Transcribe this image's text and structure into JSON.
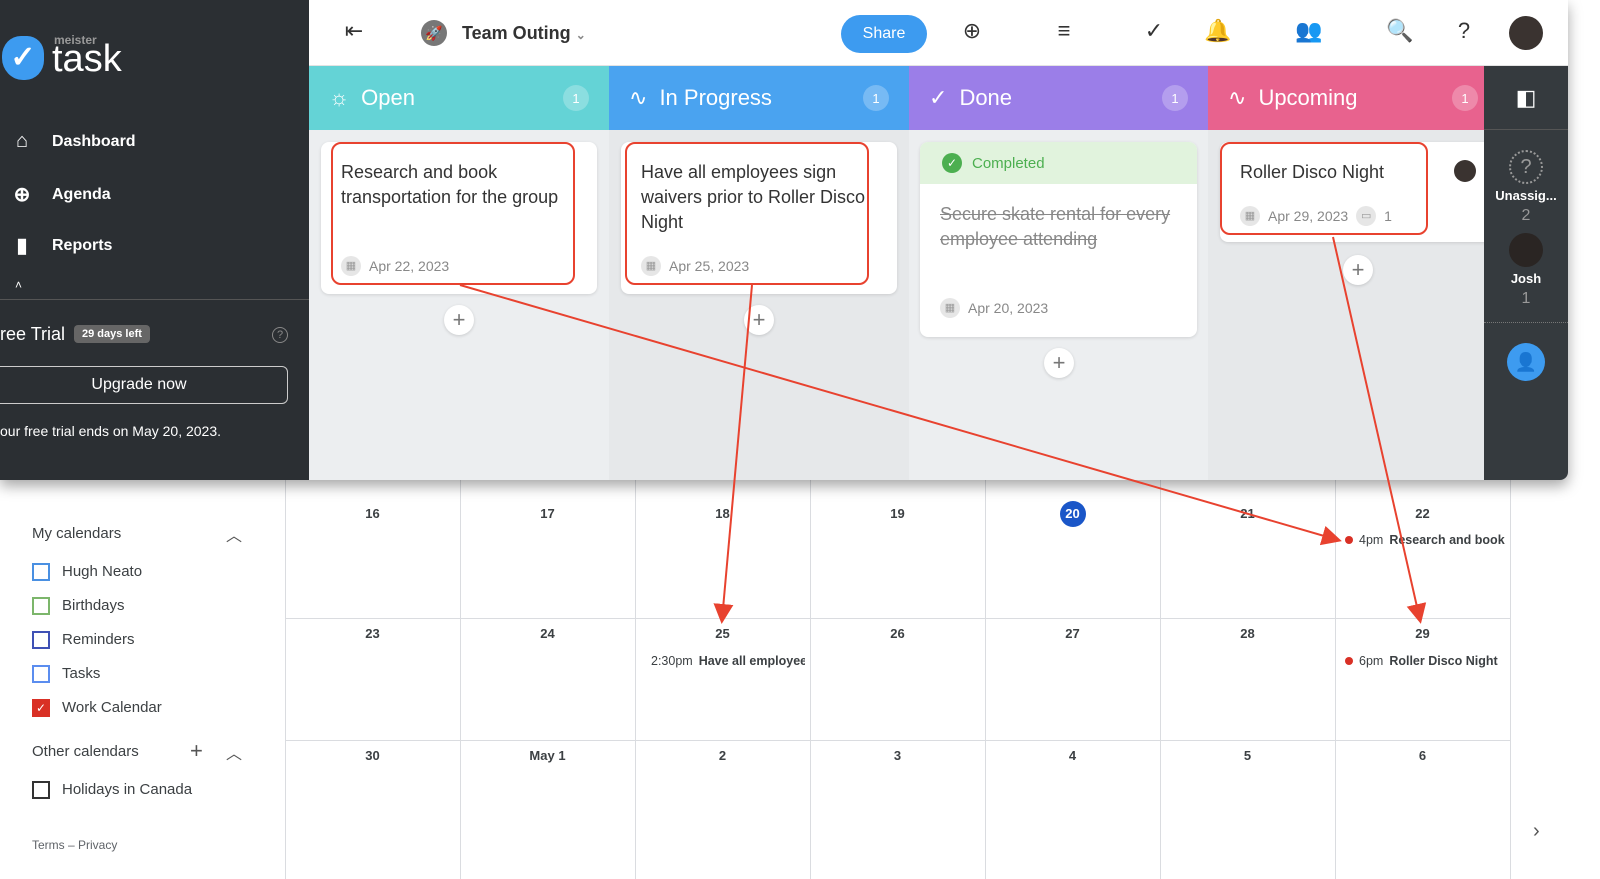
{
  "app": {
    "logo_small": "meister",
    "logo_big": "task"
  },
  "sidebar": {
    "items": [
      {
        "label": "Dashboard",
        "icon": "home-icon"
      },
      {
        "label": "Agenda",
        "icon": "pin-icon"
      },
      {
        "label": "Reports",
        "icon": "bar-chart-icon"
      }
    ],
    "trial_label": "ree Trial",
    "trial_badge": "29 days left",
    "upgrade": "Upgrade now",
    "trial_note": "our free trial ends on May 20, 2023."
  },
  "header": {
    "project": "Team Outing",
    "share": "Share"
  },
  "columns": [
    {
      "name": "Open",
      "count": "1",
      "color": "#64d3d6"
    },
    {
      "name": "In Progress",
      "count": "1",
      "color": "#4aa3f0"
    },
    {
      "name": "Done",
      "count": "1",
      "color": "#9b7ee8"
    },
    {
      "name": "Upcoming",
      "count": "1",
      "color": "#e8628e"
    }
  ],
  "cards": [
    {
      "title": "Research and book transportation for the group",
      "date": "Apr 22, 2023"
    },
    {
      "title": "Have all employees sign waivers prior to Roller Disco Night",
      "date": "Apr 25, 2023"
    },
    {
      "status": "Completed",
      "title": "Secure skate rental for every employee attending",
      "date": "Apr 20, 2023"
    },
    {
      "title": "Roller Disco Night",
      "date": "Apr 29, 2023",
      "comments": "1"
    }
  ],
  "assignees": [
    {
      "name": "Unassig...",
      "count": "2"
    },
    {
      "name": "Josh",
      "count": "1"
    }
  ],
  "calendar": {
    "my_calendars": "My calendars",
    "other_calendars": "Other calendars",
    "mine": [
      {
        "label": "Hugh Neato",
        "color": "#4a90e2",
        "checked": false
      },
      {
        "label": "Birthdays",
        "color": "#7cb66b",
        "checked": false
      },
      {
        "label": "Reminders",
        "color": "#3f51b5",
        "checked": false
      },
      {
        "label": "Tasks",
        "color": "#5b8def",
        "checked": false
      },
      {
        "label": "Work Calendar",
        "color": "#d93025",
        "checked": true
      }
    ],
    "other": [
      {
        "label": "Holidays in Canada",
        "color": "#333",
        "checked": false
      }
    ],
    "footer": "Terms – Privacy",
    "weeks": [
      [
        "16",
        "17",
        "18",
        "19",
        "20",
        "21",
        "22"
      ],
      [
        "23",
        "24",
        "25",
        "26",
        "27",
        "28",
        "29"
      ],
      [
        "30",
        "May 1",
        "2",
        "3",
        "4",
        "5",
        "6"
      ]
    ],
    "today": "20",
    "events": [
      {
        "time": "4pm",
        "title": "Research and book"
      },
      {
        "time": "2:30pm",
        "title": "Have all employees"
      },
      {
        "time": "6pm",
        "title": "Roller Disco Night"
      }
    ]
  }
}
